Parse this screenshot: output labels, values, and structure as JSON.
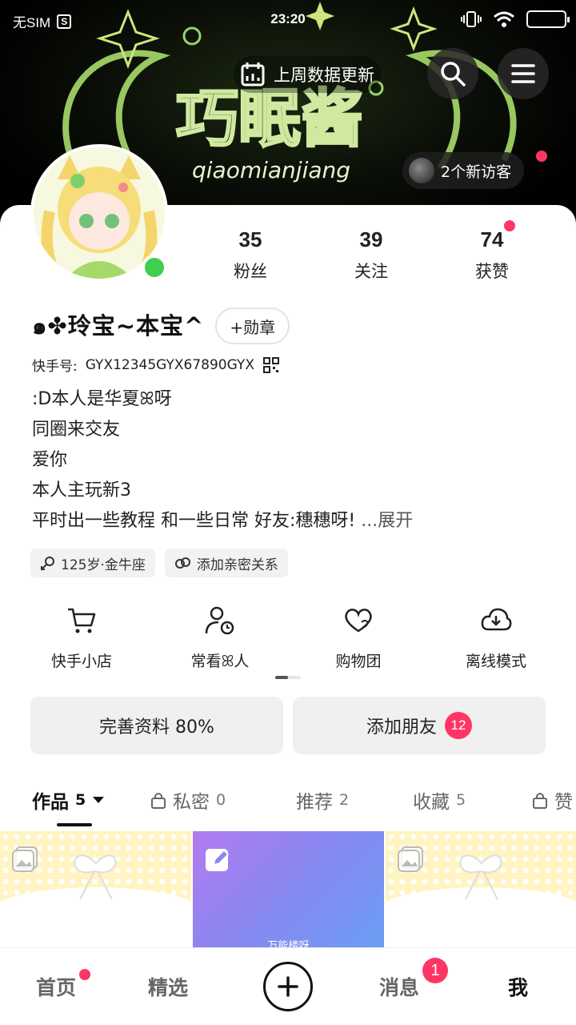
{
  "status_bar": {
    "carrier": "无SIM",
    "sim_icon": "S",
    "time": "23:20"
  },
  "header": {
    "banner_text_main": "巧眠酱",
    "banner_text_sub": "qiaomianjiang",
    "data_update": "上周数据更新",
    "visitors": "2个新访客"
  },
  "stats": [
    {
      "value": "35",
      "label": "粉丝"
    },
    {
      "value": "39",
      "label": "关注"
    },
    {
      "value": "74",
      "label": "获赞"
    }
  ],
  "profile": {
    "name": "๑✤玲宝~本宝^",
    "medal_button": "+勋章",
    "id_label": "快手号:",
    "id_value": "GYX12345GYX67890GYX",
    "bio": [
      ":D本人是华夏ꕤ呀",
      "同圈来交友",
      "爱你",
      "本人主玩新3",
      "平时出一些教程 和一些日常 好友:穗穗呀!"
    ],
    "expand": "...展开",
    "tags": [
      "125岁·金牛座",
      "添加亲密关系"
    ]
  },
  "tools": [
    {
      "label": "快手小店",
      "icon": "cart-icon"
    },
    {
      "label": "常看ꕤ人",
      "icon": "user-clock-icon"
    },
    {
      "label": "购物团",
      "icon": "heart-chat-icon"
    },
    {
      "label": "离线模式",
      "icon": "cloud-download-icon"
    }
  ],
  "actions": {
    "complete_profile": "完善资料 80%",
    "add_friends": "添加朋友",
    "add_friends_badge": "12"
  },
  "tabs": [
    {
      "label": "作品",
      "count": "5",
      "active": true
    },
    {
      "label": "私密",
      "count": "0",
      "active": false
    },
    {
      "label": "推荐",
      "count": "2",
      "active": false
    },
    {
      "label": "收藏",
      "count": "5",
      "active": false
    },
    {
      "label": "赞",
      "count": "",
      "active": false
    }
  ],
  "grid": {
    "middle_caption": "万能楼呀"
  },
  "bottom_nav": {
    "home": "首页",
    "featured": "精选",
    "messages": "消息",
    "messages_badge": "1",
    "me": "我"
  },
  "colors": {
    "accent": "#fe3666",
    "online": "#3fcf4e",
    "chip_bg": "#f2f2f2"
  }
}
